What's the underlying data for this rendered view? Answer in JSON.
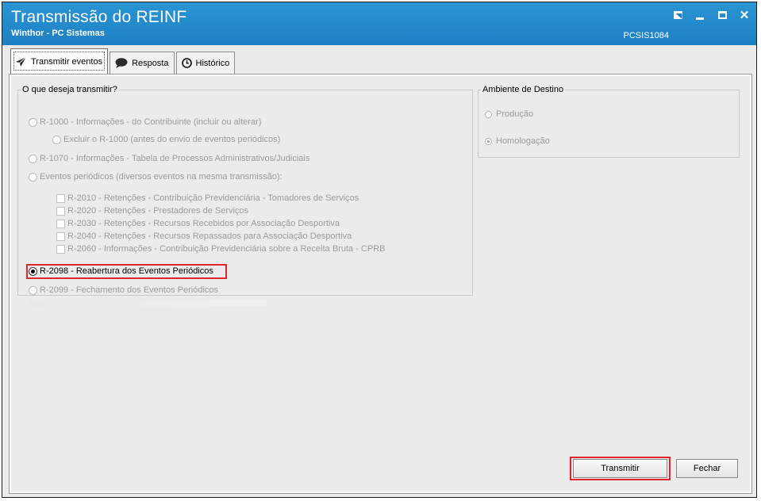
{
  "window": {
    "title": "Transmissão do REINF",
    "subtitle": "Winthor - PC Sistemas",
    "code": "PCSIS1084"
  },
  "tabs": [
    {
      "label": "Transmitir eventos",
      "icon": "send-icon",
      "active": true
    },
    {
      "label": "Resposta",
      "icon": "speech-bubble-icon",
      "active": false
    },
    {
      "label": "Histórico",
      "icon": "clock-icon",
      "active": false
    }
  ],
  "transmit_group": {
    "legend": "O que deseja transmitir?",
    "options": {
      "r1000": "R-1000 - Informações - do Contribuinte (incluir ou alterar)",
      "r1000_delete": "Excluir o R-1000 (antes do envio de eventos periódicos)",
      "r1070": "R-1070 - Informações - Tabela de Processos Administrativos/Judiciais",
      "periodic": "Eventos periódicos (diversos eventos na mesma transmissão):",
      "r2010": "R-2010 - Retenções - Contribuição Previdenciária - Tomadores de Serviços",
      "r2020": "R-2020 - Retenções - Prestadores de Serviços",
      "r2030": "R-2030 - Retenções - Recursos Recebidos por Associação Desportiva",
      "r2040": "R-2040 - Retenções - Recursos Repassados para Associação Desportiva",
      "r2060": "R-2060 - Informações - Contribuição Previdenciária sobre a Receita Bruta - CPRB",
      "r2098": "R-2098 - Reabertura dos Eventos Periódicos",
      "r2099": "R-2099 - Fechamento dos Eventos Periódicos"
    },
    "selected": "r2098"
  },
  "destination_group": {
    "legend": "Ambiente de Destino",
    "production": "Produção",
    "homologation": "Homologação",
    "selected": "homologation"
  },
  "buttons": {
    "transmit": "Transmitir",
    "close": "Fechar"
  },
  "colors": {
    "titlebar": "#1d80c4",
    "highlight": "#e0262a",
    "disabled_text": "#9b9b9b"
  }
}
